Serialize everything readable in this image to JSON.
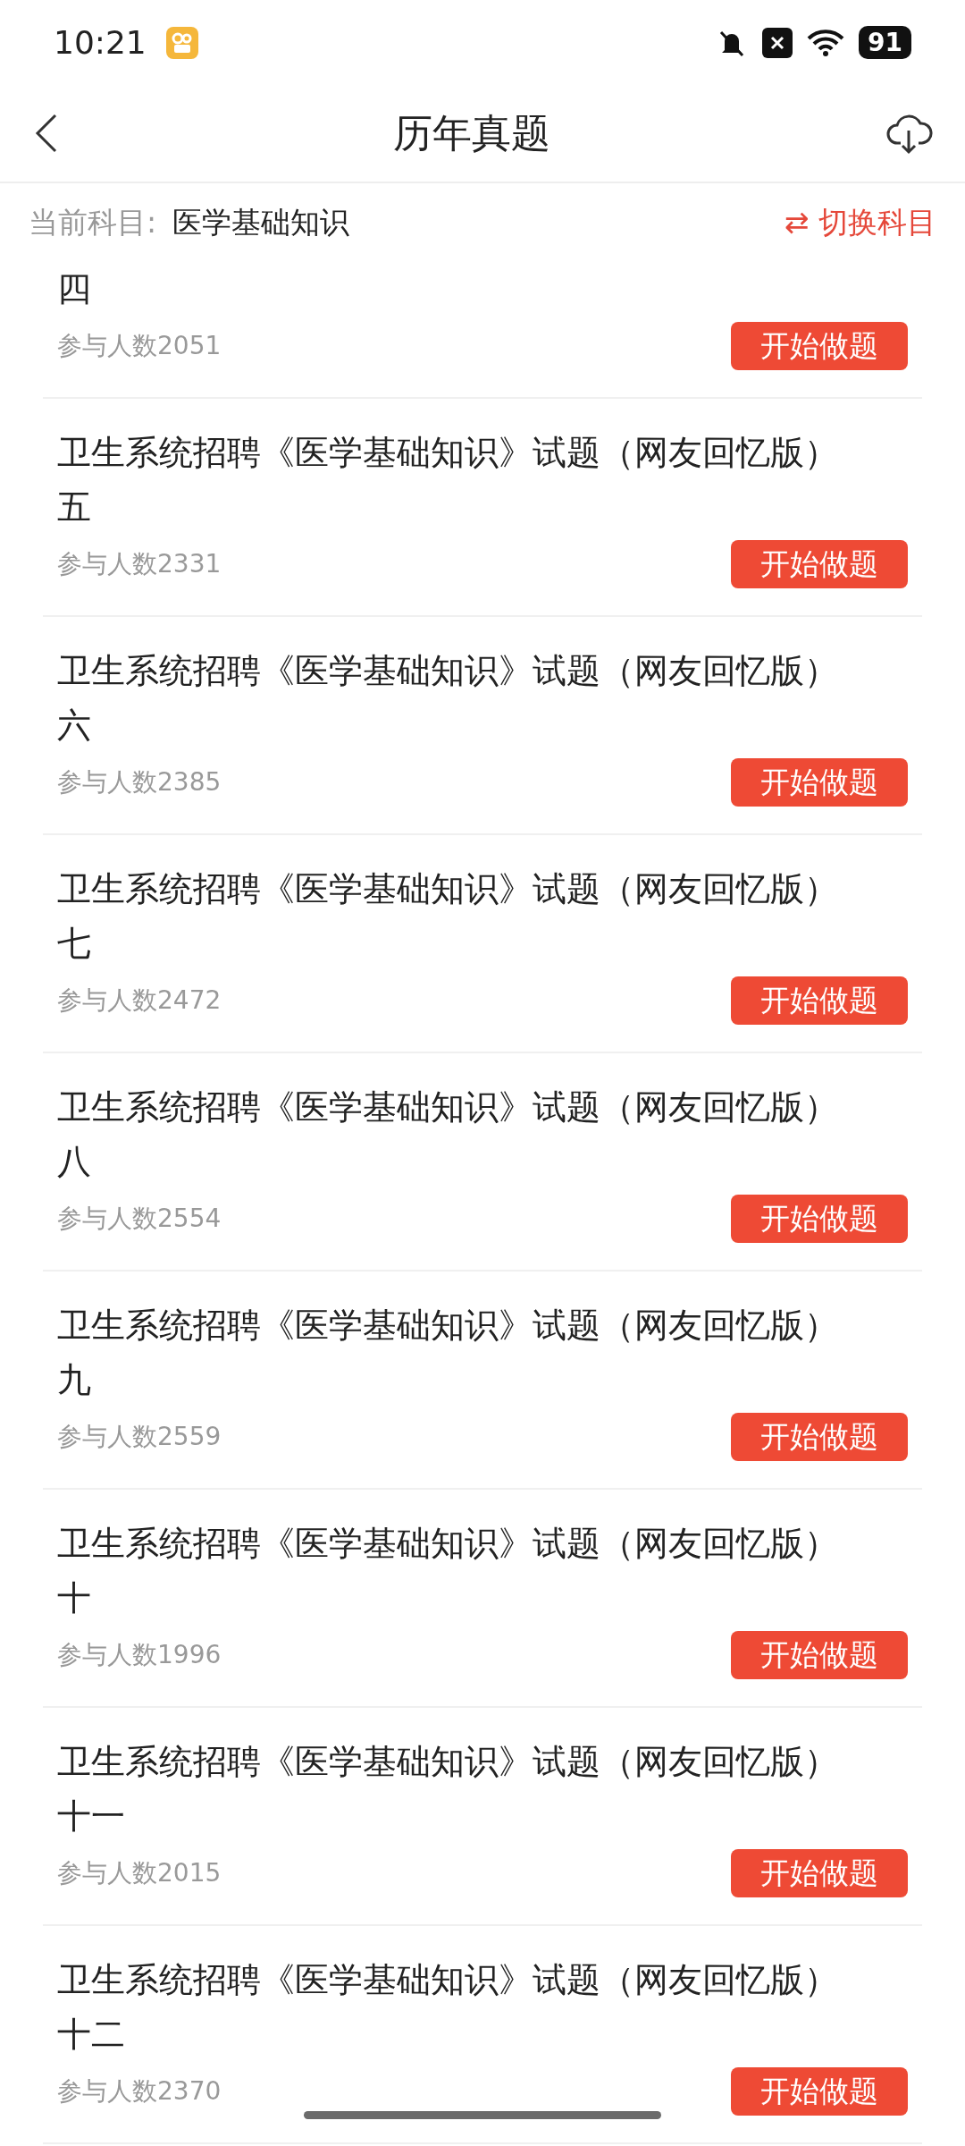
{
  "status_bar": {
    "time": "10:21",
    "battery": "91"
  },
  "header": {
    "title": "历年真题"
  },
  "subject_bar": {
    "label": "当前科目:",
    "subject": "医学基础知识",
    "switch": "⇄ 切换科目"
  },
  "items": [
    {
      "title": "四",
      "participants": "参与人数2051",
      "button": "开始做题"
    },
    {
      "title": "卫生系统招聘《医学基础知识》试题（网友回忆版）五",
      "participants": "参与人数2331",
      "button": "开始做题"
    },
    {
      "title": "卫生系统招聘《医学基础知识》试题（网友回忆版）六",
      "participants": "参与人数2385",
      "button": "开始做题"
    },
    {
      "title": "卫生系统招聘《医学基础知识》试题（网友回忆版）七",
      "participants": "参与人数2472",
      "button": "开始做题"
    },
    {
      "title": "卫生系统招聘《医学基础知识》试题（网友回忆版）八",
      "participants": "参与人数2554",
      "button": "开始做题"
    },
    {
      "title": "卫生系统招聘《医学基础知识》试题（网友回忆版）九",
      "participants": "参与人数2559",
      "button": "开始做题"
    },
    {
      "title": "卫生系统招聘《医学基础知识》试题（网友回忆版）十",
      "participants": "参与人数1996",
      "button": "开始做题"
    },
    {
      "title": "卫生系统招聘《医学基础知识》试题（网友回忆版）十一",
      "participants": "参与人数2015",
      "button": "开始做题"
    },
    {
      "title": "卫生系统招聘《医学基础知识》试题（网友回忆版）十二",
      "participants": "参与人数2370",
      "button": "开始做题"
    }
  ]
}
